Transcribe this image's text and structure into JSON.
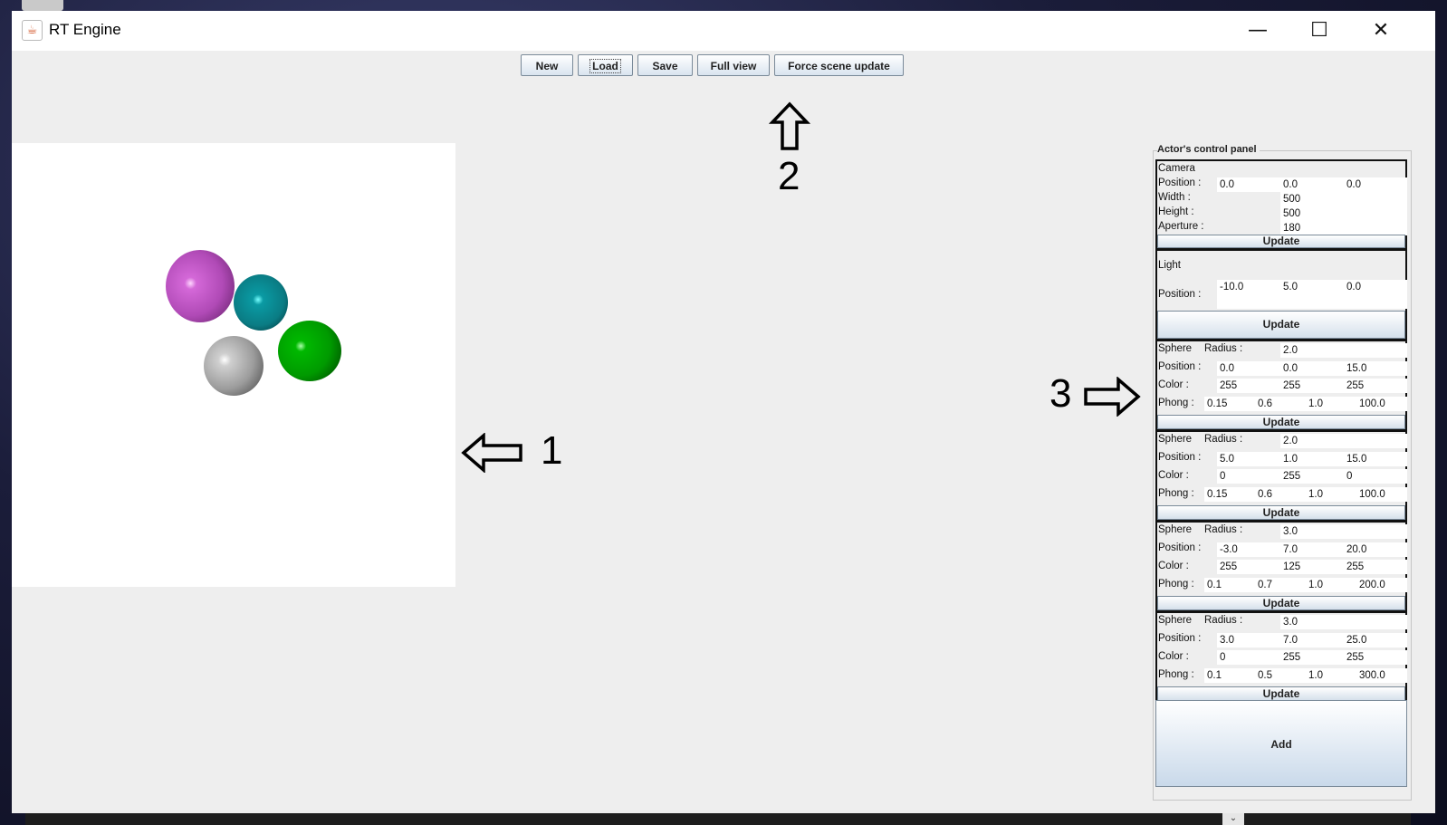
{
  "window": {
    "title": "RT Engine"
  },
  "toolbar": {
    "new": "New",
    "load": "Load",
    "save": "Save",
    "full_view": "Full view",
    "force_update": "Force scene update"
  },
  "annotations": {
    "one": "1",
    "two": "2",
    "three": "3"
  },
  "canvas": {
    "spheres": [
      {
        "color": "#b94cc0",
        "desc": "magenta sphere"
      },
      {
        "color": "#0e8c94",
        "desc": "cyan sphere"
      },
      {
        "color": "#00a000",
        "desc": "green sphere"
      },
      {
        "color": "#9a9a9a",
        "desc": "gray sphere"
      }
    ]
  },
  "panel": {
    "title": "Actor's control panel",
    "update_label": "Update",
    "add_label": "Add",
    "labels": {
      "position": "Position :",
      "color": "Color :",
      "phong": "Phong :",
      "sphere": "Sphere",
      "radius": "Radius :"
    },
    "camera": {
      "name": "Camera",
      "position_label": "Position :",
      "position": [
        "0.0",
        "0.0",
        "0.0"
      ],
      "width_label": "Width :",
      "width": "500",
      "height_label": "Height :",
      "height": "500",
      "aperture_label": "Aperture :",
      "aperture": "180"
    },
    "light": {
      "name": "Light",
      "position_label": "Position :",
      "position": [
        "-10.0",
        "5.0",
        "0.0"
      ]
    },
    "spheres": [
      {
        "radius": "2.0",
        "position": [
          "0.0",
          "0.0",
          "15.0"
        ],
        "color": [
          "255",
          "255",
          "255"
        ],
        "phong": [
          "0.15",
          "0.6",
          "1.0",
          "100.0"
        ]
      },
      {
        "radius": "2.0",
        "position": [
          "5.0",
          "1.0",
          "15.0"
        ],
        "color": [
          "0",
          "255",
          "0"
        ],
        "phong": [
          "0.15",
          "0.6",
          "1.0",
          "100.0"
        ]
      },
      {
        "radius": "3.0",
        "position": [
          "-3.0",
          "7.0",
          "20.0"
        ],
        "color": [
          "255",
          "125",
          "255"
        ],
        "phong": [
          "0.1",
          "0.7",
          "1.0",
          "200.0"
        ]
      },
      {
        "radius": "3.0",
        "position": [
          "3.0",
          "7.0",
          "25.0"
        ],
        "color": [
          "0",
          "255",
          "255"
        ],
        "phong": [
          "0.1",
          "0.5",
          "1.0",
          "300.0"
        ]
      }
    ]
  }
}
